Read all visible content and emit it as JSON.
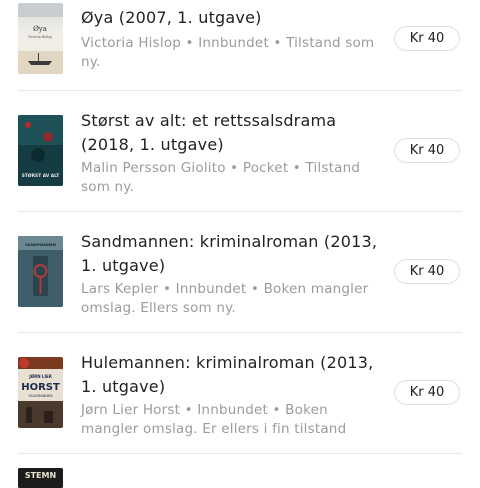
{
  "books": [
    {
      "title": "Øya (2007, 1. utgave)",
      "meta": "Victoria Hislop • Innbundet • Tilstand som ny.",
      "price": "Kr 40",
      "cover": {
        "icon": "book-cover-oya",
        "text_top": "Øya",
        "text_author": "Victoria Hislop"
      }
    },
    {
      "title": "Størst av alt: et rettssalsdrama (2018, 1. utgave)",
      "meta": "Malin Persson Giolito • Pocket • Tilstand som ny.",
      "price": "Kr 40",
      "cover": {
        "icon": "book-cover-storst-av-alt",
        "text_bottom": "STØRST AV ALT"
      }
    },
    {
      "title": "Sandmannen: kriminalroman (2013, 1. utgave)",
      "meta": "Lars Kepler • Innbundet • Boken mangler omslag. Ellers som ny.",
      "price": "Kr 40",
      "cover": {
        "icon": "book-cover-sandmannen",
        "text_top": "SANDMANNEN"
      }
    },
    {
      "title": "Hulemannen: kriminalroman (2013, 1. utgave)",
      "meta": "Jørn Lier Horst • Innbundet • Boken mangler omslag. Er ellers i fin tilstand",
      "price": "Kr 40",
      "cover": {
        "icon": "book-cover-hulemannen",
        "text_author": "JØRN LIER",
        "text_title": "HORST",
        "text_sub": "HULEMANNEN"
      }
    },
    {
      "cover": {
        "icon": "book-cover-partial",
        "text_top": "STEMN"
      }
    }
  ]
}
